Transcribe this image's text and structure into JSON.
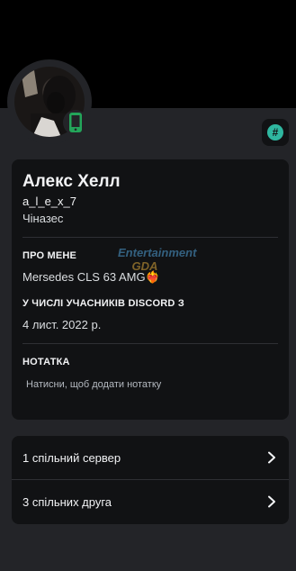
{
  "profile": {
    "display_name": "Алекс Хелл",
    "username": "a_l_e_x_7",
    "pronouns": "Чіназес"
  },
  "about": {
    "title": "ПРО МЕНЕ",
    "text": "Mersedes CLS 63 AMG❤️‍🔥"
  },
  "member_since": {
    "title": "У ЧИСЛІ УЧАСНИКІВ DISCORD З",
    "date": "4 лист. 2022 р."
  },
  "note": {
    "title": "НОТАТКА",
    "placeholder": "Натисни, щоб додати нотатку"
  },
  "mutual": {
    "servers": "1 спільний сервер",
    "friends": "3 спільних друга"
  },
  "watermark": {
    "line1": "Entertainment",
    "line2": "GDA"
  },
  "colors": {
    "sheet_bg": "#232428",
    "card_bg": "#111214",
    "accent_teal": "#2fb7a0",
    "mobile_green": "#23a55a"
  }
}
